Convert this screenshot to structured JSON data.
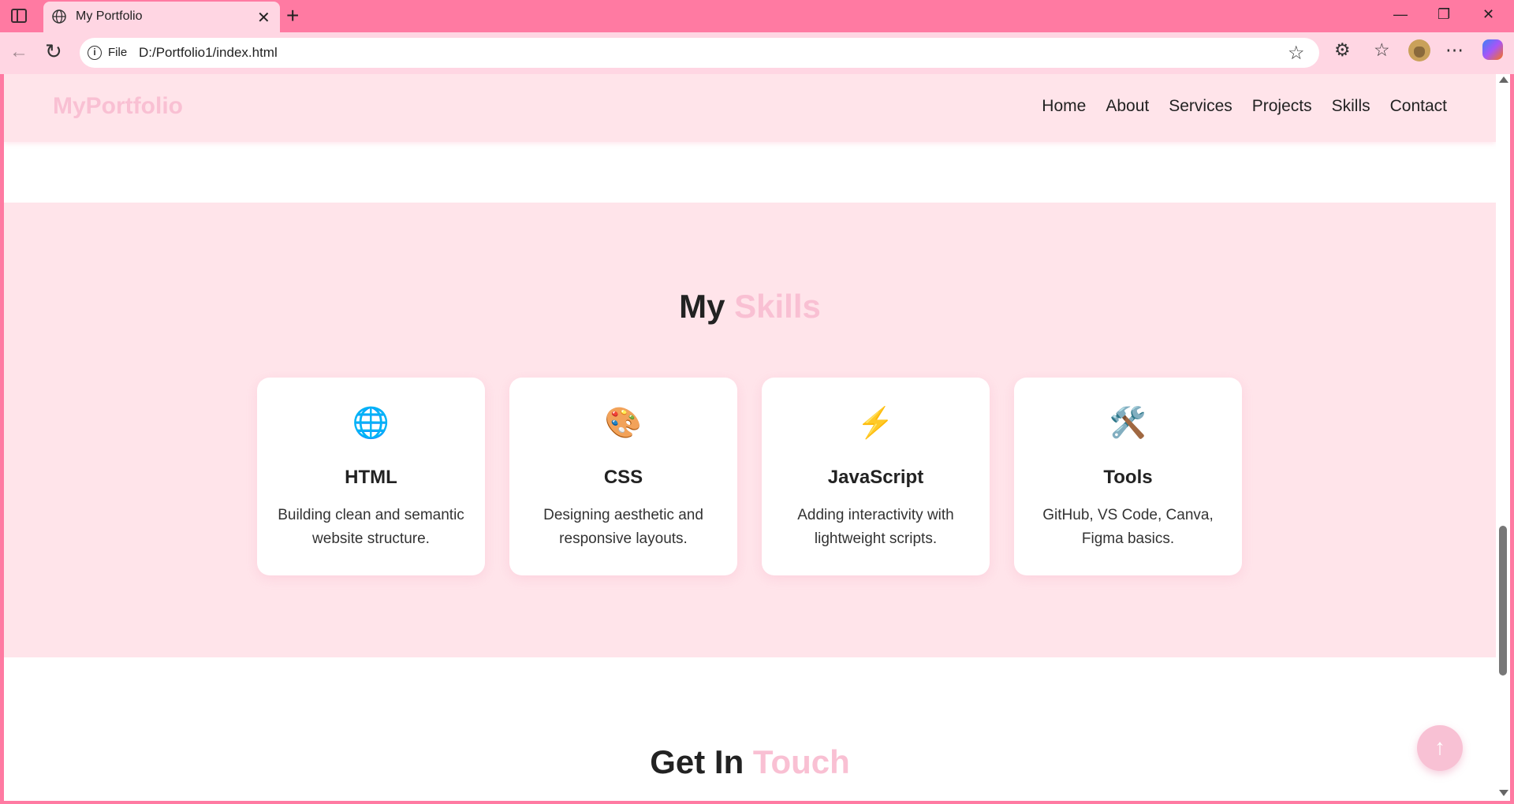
{
  "browser": {
    "tab_title": "My Portfolio",
    "tab_close": "✕",
    "new_tab": "+",
    "window_controls": {
      "minimize": "—",
      "restore": "❐",
      "close": "✕"
    },
    "address": {
      "scheme_label": "File",
      "url": "D:/Portfolio1/index.html"
    }
  },
  "site": {
    "logo": "MyPortfolio",
    "nav": [
      "Home",
      "About",
      "Services",
      "Projects",
      "Skills",
      "Contact"
    ]
  },
  "skills": {
    "title_main": "My",
    "title_accent": "Skills",
    "cards": [
      {
        "icon": "🌐",
        "icon_name": "globe-icon",
        "title": "HTML",
        "text": "Building clean and semantic website structure."
      },
      {
        "icon": "🎨",
        "icon_name": "palette-icon",
        "title": "CSS",
        "text": "Designing aesthetic and responsive layouts."
      },
      {
        "icon": "⚡",
        "icon_name": "lightning-icon",
        "title": "JavaScript",
        "text": "Adding interactivity with lightweight scripts."
      },
      {
        "icon": "🛠️",
        "icon_name": "tools-icon",
        "title": "Tools",
        "text": "GitHub, VS Code, Canva, Figma basics."
      }
    ]
  },
  "contact": {
    "title_main": "Get In",
    "title_accent": "Touch"
  },
  "back_to_top": "↑",
  "colors": {
    "browser_frame": "#ff7aa2",
    "toolbar": "#ffd6e3",
    "section_bg": "#ffe4ea",
    "accent": "#f9c0d3",
    "back_to_top": "#f8c1d4"
  }
}
